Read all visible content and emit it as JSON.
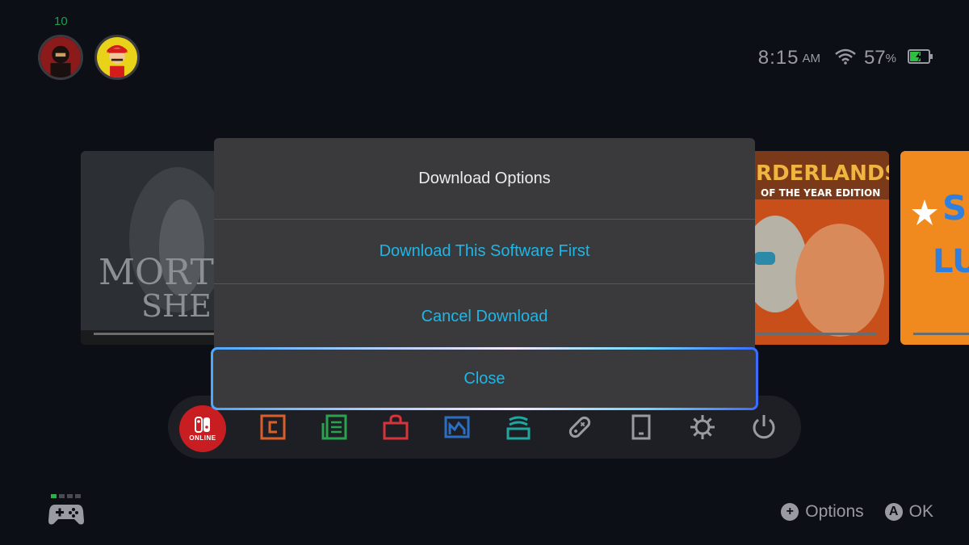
{
  "topbar": {
    "notification_count": "10",
    "users": [
      {
        "name": "user-avatar-1"
      },
      {
        "name": "user-avatar-2"
      }
    ],
    "time": "8:15",
    "ampm": "AM",
    "battery_percent": "57",
    "battery_sign": "%"
  },
  "games": [
    {
      "title_art": "MORTAL SHELL"
    },
    {
      "title_art": "BORDERLANDS GAME OF THE YEAR EDITION"
    },
    {
      "title_art": "SUPER LUCKY"
    }
  ],
  "dialog": {
    "title": "Download Options",
    "options": [
      {
        "label": "Download This Software First"
      },
      {
        "label": "Cancel Download"
      }
    ],
    "close_label": "Close"
  },
  "menubar": {
    "online_label": "ONLINE",
    "items": [
      "nintendo-online",
      "news",
      "eshop",
      "album",
      "controllers",
      "settings",
      "sleep"
    ]
  },
  "bottom": {
    "options_label": "Options",
    "options_button": "+",
    "ok_label": "OK",
    "ok_button": "A"
  },
  "colors": {
    "accent": "#1fb6e6",
    "background": "#0d0f17",
    "dialog": "#3a3a3c",
    "online_red": "#c81e22"
  }
}
